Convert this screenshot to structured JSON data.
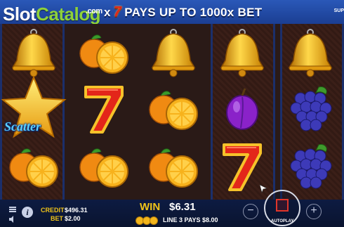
{
  "watermark": {
    "logo_slot": "Slot",
    "logo_catalog": "Catalog",
    "logo_com": ".com"
  },
  "banner": {
    "prefix": "x",
    "seven": "7",
    "text": "PAYS UP TO 1000x BET",
    "sup": "SUP"
  },
  "reels": [
    [
      "bell-icon",
      "star-scatter-icon",
      "orange-icon"
    ],
    [
      "orange-icon",
      "seven-icon",
      "orange-icon"
    ],
    [
      "bell-icon",
      "orange-icon",
      "orange-icon"
    ],
    [
      "bell-icon",
      "plum-icon",
      "seven-icon"
    ],
    [
      "bell-icon",
      "grapes-icon",
      "grapes-icon"
    ]
  ],
  "scatter_label": "Scatter",
  "bottom": {
    "credit_label": "CREDIT",
    "credit_value": "$496.31",
    "bet_label": "BET",
    "bet_value": "$2.00",
    "win_label": "WIN",
    "win_value": "$6.31",
    "line_pays": "LINE 3 PAYS $8.00",
    "autoplay": "AUTOPLAY",
    "minus": "−",
    "plus": "+"
  }
}
